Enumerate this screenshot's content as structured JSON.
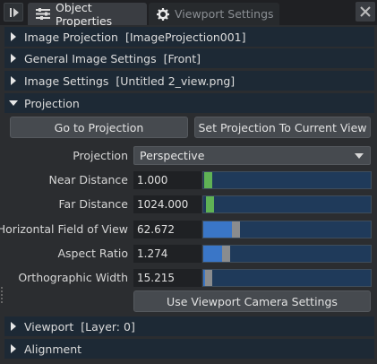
{
  "tabs": {
    "active_label": "Object Properties",
    "inactive_label": "Viewport Settings"
  },
  "sections": {
    "image_projection": {
      "label": "Image Projection",
      "detail": "[ImageProjection001]"
    },
    "general_image_settings": {
      "label": "General Image Settings",
      "detail": "[Front]"
    },
    "image_settings": {
      "label": "Image Settings",
      "detail": "[Untitled 2_view.png]"
    },
    "projection": {
      "label": "Projection"
    },
    "viewport": {
      "label": "Viewport",
      "detail": "[Layer: 0]"
    },
    "alignment": {
      "label": "Alignment"
    }
  },
  "buttons": {
    "go_to_projection": "Go to Projection",
    "set_projection": "Set Projection To Current View",
    "use_viewport_camera": "Use Viewport Camera Settings"
  },
  "projection_field": {
    "label": "Projection",
    "value": "Perspective"
  },
  "fields": {
    "near_distance": {
      "label": "Near Distance",
      "value": "1.000",
      "slider_fraction": 0.0
    },
    "far_distance": {
      "label": "Far Distance",
      "value": "1024.000",
      "slider_fraction": 0.0
    },
    "horizontal_fov": {
      "label": "Horizontal Field of View",
      "value": "62.672",
      "slider_fraction": 0.17
    },
    "aspect_ratio": {
      "label": "Aspect Ratio",
      "value": "1.274",
      "slider_fraction": 0.11
    },
    "ortho_width": {
      "label": "Orthographic Width",
      "value": "15.215",
      "slider_fraction": 0.0
    }
  },
  "colors": {
    "section_bg": "#1d2935",
    "slider_track": "#1f3a5a",
    "slider_fill": "#3a76c7",
    "handle_green": "#5fb255",
    "handle_gray": "#8a8c8e"
  }
}
